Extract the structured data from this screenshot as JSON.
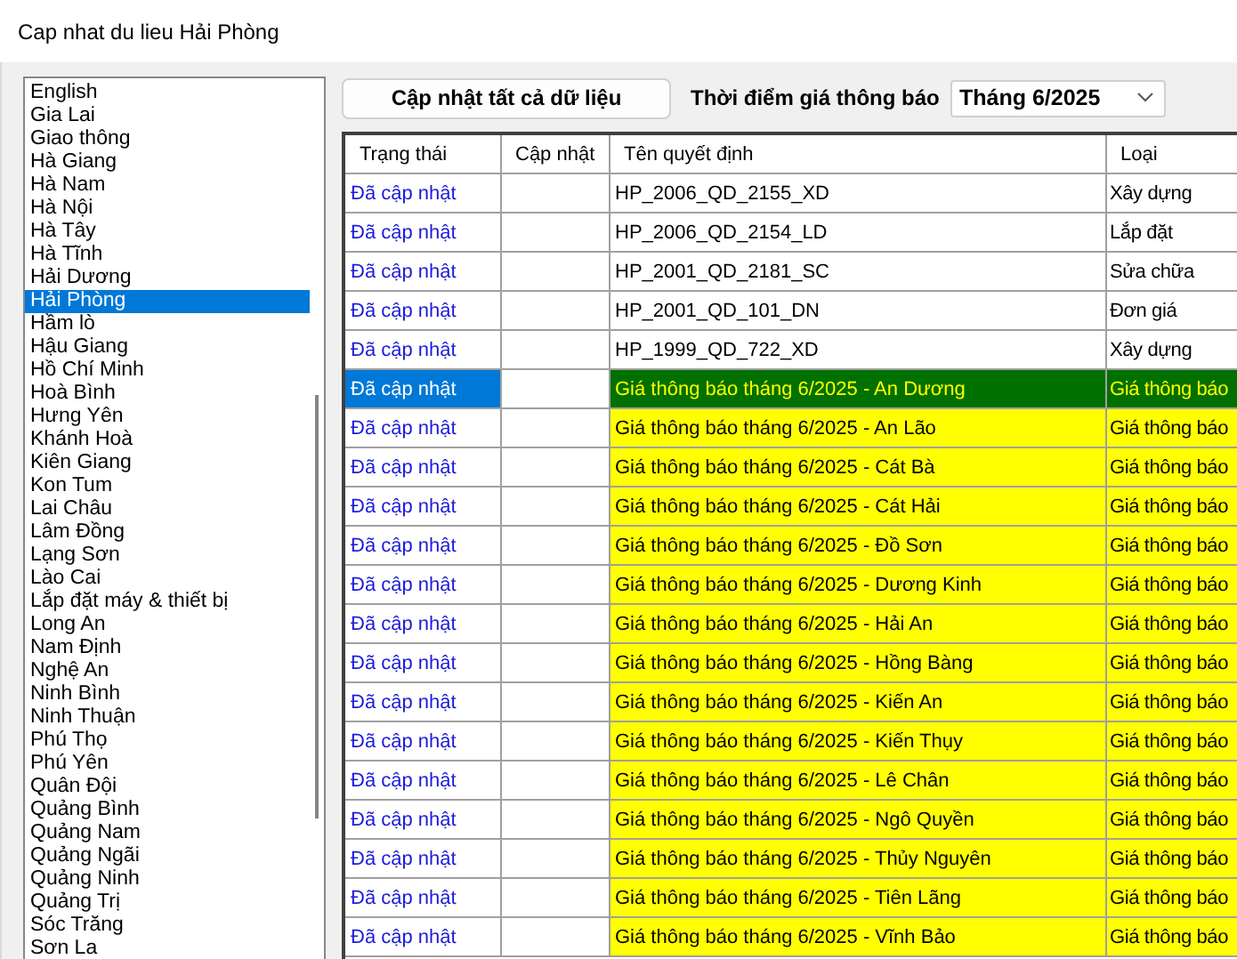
{
  "window": {
    "title": "Cap nhat du lieu Hải Phòng"
  },
  "sidebar": {
    "items": [
      {
        "label": "English",
        "selected": false
      },
      {
        "label": "Gia Lai",
        "selected": false
      },
      {
        "label": "Giao thông",
        "selected": false
      },
      {
        "label": "Hà Giang",
        "selected": false
      },
      {
        "label": "Hà Nam",
        "selected": false
      },
      {
        "label": "Hà Nội",
        "selected": false
      },
      {
        "label": "Hà Tây",
        "selected": false
      },
      {
        "label": "Hà Tĩnh",
        "selected": false
      },
      {
        "label": "Hải Dương",
        "selected": false
      },
      {
        "label": "Hải Phòng",
        "selected": true
      },
      {
        "label": "Hầm lò",
        "selected": false
      },
      {
        "label": "Hậu Giang",
        "selected": false
      },
      {
        "label": "Hồ Chí Minh",
        "selected": false
      },
      {
        "label": "Hoà Bình",
        "selected": false
      },
      {
        "label": "Hưng Yên",
        "selected": false
      },
      {
        "label": "Khánh Hoà",
        "selected": false
      },
      {
        "label": "Kiên Giang",
        "selected": false
      },
      {
        "label": "Kon Tum",
        "selected": false
      },
      {
        "label": "Lai Châu",
        "selected": false
      },
      {
        "label": "Lâm Đồng",
        "selected": false
      },
      {
        "label": "Lạng Sơn",
        "selected": false
      },
      {
        "label": "Lào Cai",
        "selected": false
      },
      {
        "label": "Lắp đặt máy & thiết bị",
        "selected": false
      },
      {
        "label": "Long An",
        "selected": false
      },
      {
        "label": "Nam Định",
        "selected": false
      },
      {
        "label": "Nghệ An",
        "selected": false
      },
      {
        "label": "Ninh Bình",
        "selected": false
      },
      {
        "label": "Ninh Thuận",
        "selected": false
      },
      {
        "label": "Phú Thọ",
        "selected": false
      },
      {
        "label": "Phú Yên",
        "selected": false
      },
      {
        "label": "Quân Đội",
        "selected": false
      },
      {
        "label": "Quảng Bình",
        "selected": false
      },
      {
        "label": "Quảng Nam",
        "selected": false
      },
      {
        "label": "Quảng Ngãi",
        "selected": false
      },
      {
        "label": "Quảng Ninh",
        "selected": false
      },
      {
        "label": "Quảng Trị",
        "selected": false
      },
      {
        "label": "Sóc Trăng",
        "selected": false
      },
      {
        "label": "Sơn La",
        "selected": false
      }
    ]
  },
  "toolbar": {
    "update_all_button": "Cập nhật tất cả dữ liệu",
    "period_label": "Thời điểm giá thông báo",
    "period_select": "Tháng 6/2025"
  },
  "table": {
    "columns": [
      "Trạng thái",
      "Cập nhật",
      "Tên quyết định",
      "Loại"
    ],
    "rows": [
      {
        "kind": "decision",
        "selected": false,
        "status": "Đã cập nhật",
        "name": "HP_2006_QD_2155_XD",
        "type": "Xây dựng"
      },
      {
        "kind": "decision",
        "selected": false,
        "status": "Đã cập nhật",
        "name": "HP_2006_QD_2154_LD",
        "type": "Lắp đặt"
      },
      {
        "kind": "decision",
        "selected": false,
        "status": "Đã cập nhật",
        "name": "HP_2001_QD_2181_SC",
        "type": "Sửa chữa"
      },
      {
        "kind": "decision",
        "selected": false,
        "status": "Đã cập nhật",
        "name": "HP_2001_QD_101_DN",
        "type": "Đơn giá"
      },
      {
        "kind": "decision",
        "selected": false,
        "status": "Đã cập nhật",
        "name": "HP_1999_QD_722_XD",
        "type": "Xây dựng"
      },
      {
        "kind": "notice",
        "selected": true,
        "status": "Đã cập nhật",
        "name": "Giá thông báo tháng 6/2025 - An Dương",
        "type": "Giá thông báo"
      },
      {
        "kind": "notice",
        "selected": false,
        "status": "Đã cập nhật",
        "name": "Giá thông báo tháng 6/2025 - An Lão",
        "type": "Giá thông báo"
      },
      {
        "kind": "notice",
        "selected": false,
        "status": "Đã cập nhật",
        "name": "Giá thông báo tháng 6/2025 - Cát Bà",
        "type": "Giá thông báo"
      },
      {
        "kind": "notice",
        "selected": false,
        "status": "Đã cập nhật",
        "name": "Giá thông báo tháng 6/2025 - Cát Hải",
        "type": "Giá thông báo"
      },
      {
        "kind": "notice",
        "selected": false,
        "status": "Đã cập nhật",
        "name": "Giá thông báo tháng 6/2025 - Đồ Sơn",
        "type": "Giá thông báo"
      },
      {
        "kind": "notice",
        "selected": false,
        "status": "Đã cập nhật",
        "name": "Giá thông báo tháng 6/2025 - Dương Kinh",
        "type": "Giá thông báo"
      },
      {
        "kind": "notice",
        "selected": false,
        "status": "Đã cập nhật",
        "name": "Giá thông báo tháng 6/2025 - Hải An",
        "type": "Giá thông báo"
      },
      {
        "kind": "notice",
        "selected": false,
        "status": "Đã cập nhật",
        "name": "Giá thông báo tháng 6/2025 - Hồng Bàng",
        "type": "Giá thông báo"
      },
      {
        "kind": "notice",
        "selected": false,
        "status": "Đã cập nhật",
        "name": "Giá thông báo tháng 6/2025 - Kiến An",
        "type": "Giá thông báo"
      },
      {
        "kind": "notice",
        "selected": false,
        "status": "Đã cập nhật",
        "name": "Giá thông báo tháng 6/2025 - Kiến Thụy",
        "type": "Giá thông báo"
      },
      {
        "kind": "notice",
        "selected": false,
        "status": "Đã cập nhật",
        "name": "Giá thông báo tháng 6/2025 - Lê Chân",
        "type": "Giá thông báo"
      },
      {
        "kind": "notice",
        "selected": false,
        "status": "Đã cập nhật",
        "name": "Giá thông báo tháng 6/2025 - Ngô Quyền",
        "type": "Giá thông báo"
      },
      {
        "kind": "notice",
        "selected": false,
        "status": "Đã cập nhật",
        "name": "Giá thông báo tháng 6/2025 - Thủy Nguyên",
        "type": "Giá thông báo"
      },
      {
        "kind": "notice",
        "selected": false,
        "status": "Đã cập nhật",
        "name": "Giá thông báo tháng 6/2025 - Tiên Lãng",
        "type": "Giá thông báo"
      },
      {
        "kind": "notice",
        "selected": false,
        "status": "Đã cập nhật",
        "name": "Giá thông báo tháng 6/2025 - Vĩnh Bảo",
        "type": "Giá thông báo"
      }
    ]
  }
}
